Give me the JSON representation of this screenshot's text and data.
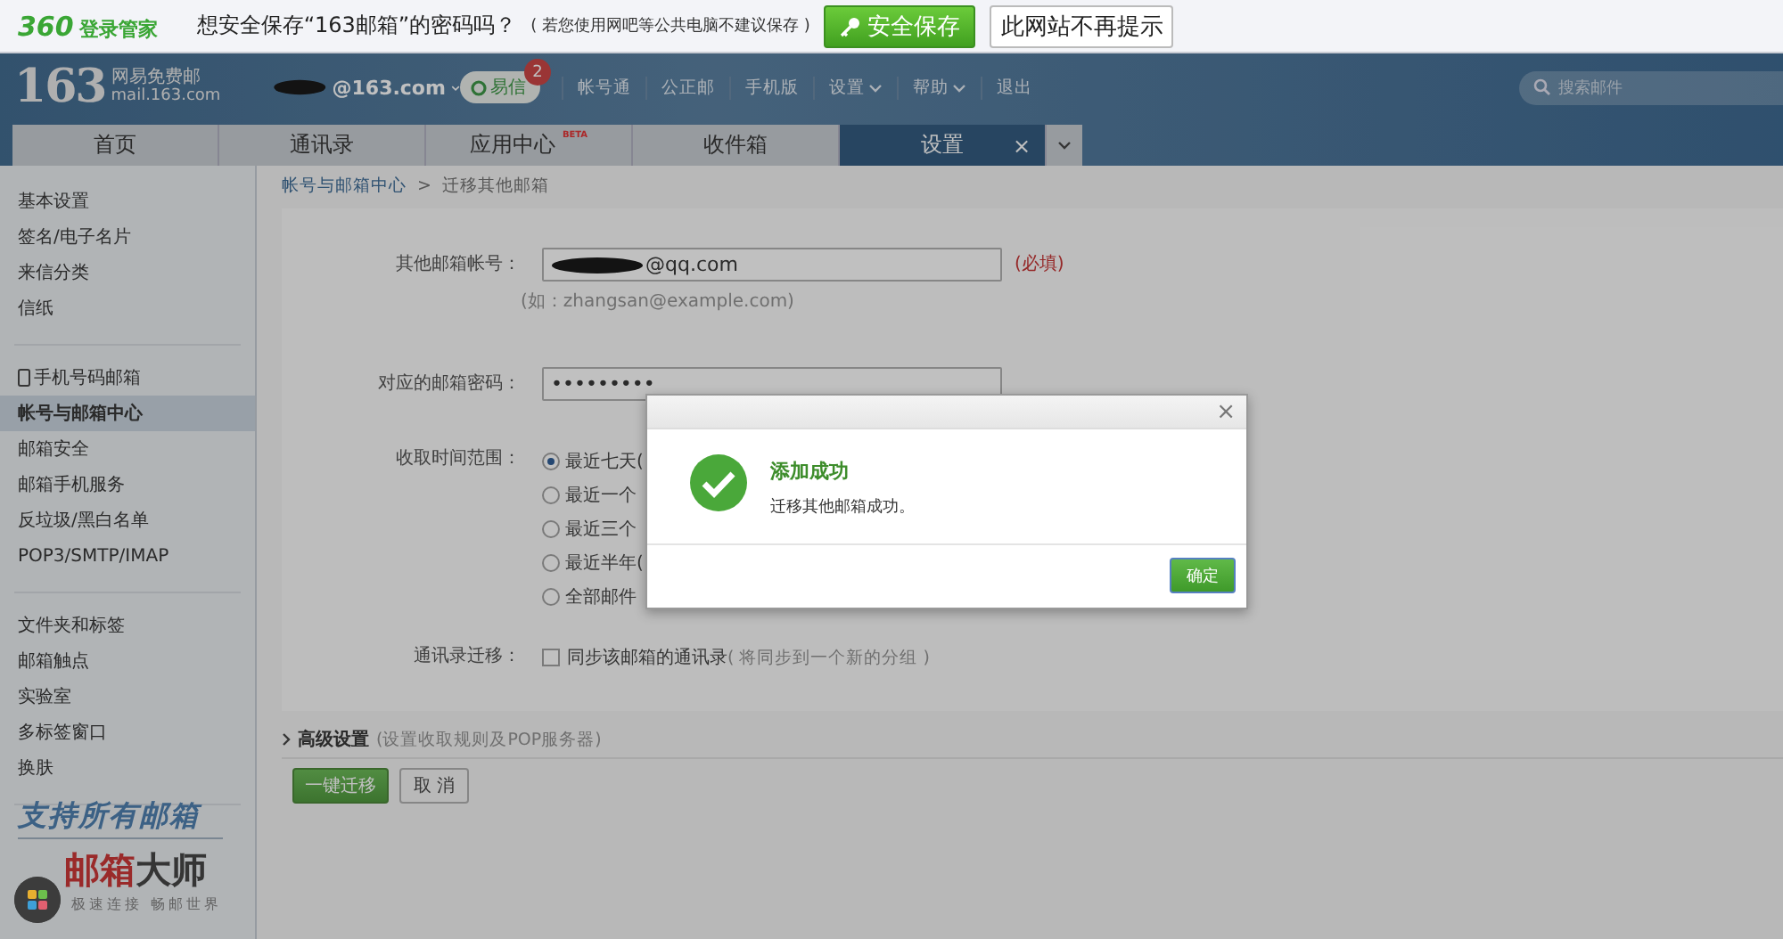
{
  "prompt_bar": {
    "brand_number": "360",
    "brand_name": "登录管家",
    "question": "想安全保存“163邮箱”的密码吗？",
    "hint": "( 若您使用网吧等公共电脑不建议保存 )",
    "save_button": "安全保存",
    "dismiss_button": "此网站不再提示"
  },
  "header": {
    "logo_number": "163",
    "logo_name": "网易免费邮",
    "logo_url": "mail.163.com",
    "account": "@163.com",
    "yixin": {
      "label": "易信",
      "badge": "2"
    },
    "links": [
      {
        "label": "帐号通",
        "dropdown": false
      },
      {
        "label": "公正邮",
        "dropdown": false
      },
      {
        "label": "手机版",
        "dropdown": false
      },
      {
        "label": "设置",
        "dropdown": true
      },
      {
        "label": "帮助",
        "dropdown": true
      },
      {
        "label": "退出",
        "dropdown": false
      }
    ],
    "search": {
      "placeholder": "搜索邮件"
    }
  },
  "tabs": [
    {
      "label": "首页",
      "selected": false
    },
    {
      "label": "通讯录",
      "selected": false
    },
    {
      "label": "应用中心",
      "selected": false,
      "badge": "BETA"
    },
    {
      "label": "收件箱",
      "selected": false
    },
    {
      "label": "设置",
      "selected": true,
      "close": "×"
    }
  ],
  "sidebar": {
    "groups": [
      [
        {
          "label": "基本设置",
          "selected": false
        },
        {
          "label": "签名/电子名片",
          "selected": false
        },
        {
          "label": "来信分类",
          "selected": false
        },
        {
          "label": "信纸",
          "selected": false
        }
      ],
      [
        {
          "label": "手机号码邮箱",
          "selected": false,
          "kind": "phone"
        },
        {
          "label": "帐号与邮箱中心",
          "selected": true
        },
        {
          "label": "邮箱安全",
          "selected": false
        },
        {
          "label": "邮箱手机服务",
          "selected": false
        },
        {
          "label": "反垃圾/黑白名单",
          "selected": false
        },
        {
          "label": "POP3/SMTP/IMAP",
          "selected": false
        }
      ],
      [
        {
          "label": "文件夹和标签",
          "selected": false
        },
        {
          "label": "邮箱触点",
          "selected": false
        },
        {
          "label": "实验室",
          "selected": false
        },
        {
          "label": "多标签窗口",
          "selected": false
        },
        {
          "label": "换肤",
          "selected": false
        }
      ]
    ],
    "promo": {
      "slogan": "支持所有邮箱",
      "brand_red": "邮箱",
      "brand_dark": "大师",
      "tagline": "极速连接  畅邮世界"
    }
  },
  "breadcrumb": {
    "parent": "帐号与邮箱中心",
    "separator": ">",
    "current": "迁移其他邮箱"
  },
  "form": {
    "account": {
      "label": "其他邮箱帐号：",
      "value": "@qq.com",
      "required": "(必填)",
      "example": "(如：zhangsan@example.com)"
    },
    "password": {
      "label": "对应的邮箱密码：",
      "value": "•••••••••"
    },
    "range": {
      "label": "收取时间范围：",
      "options": [
        {
          "label": "最近七天(",
          "selected": true
        },
        {
          "label": "最近一个",
          "selected": false
        },
        {
          "label": "最近三个",
          "selected": false
        },
        {
          "label": "最近半年(",
          "selected": false
        },
        {
          "label": "全部邮件",
          "selected": false
        }
      ]
    },
    "contacts": {
      "label": "通讯录迁移：",
      "checked": false,
      "option": "同步该邮箱的通讯录",
      "note": "( 将同步到一个新的分组 )"
    },
    "advanced": {
      "label": "高级设置",
      "note": "(设置收取规则及POP服务器)"
    },
    "buttons": {
      "primary": "一键迁移",
      "secondary": "取 消"
    }
  },
  "dialog": {
    "close": "×",
    "title": "添加成功",
    "message": "迁移其他邮箱成功。",
    "ok": "确定"
  }
}
